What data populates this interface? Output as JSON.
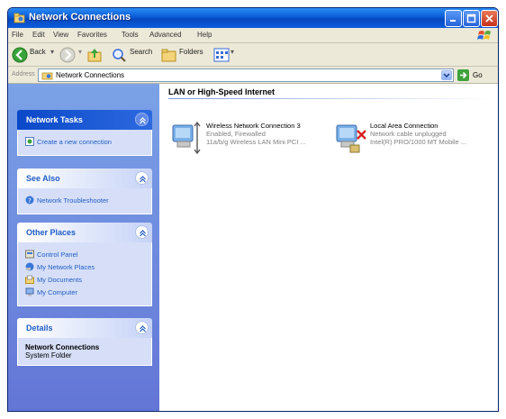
{
  "window": {
    "title": "Network Connections"
  },
  "menu": [
    "File",
    "Edit",
    "View",
    "Favorites",
    "Tools",
    "Advanced",
    "Help"
  ],
  "toolbar": {
    "back_label": "Back",
    "search_label": "Search",
    "folders_label": "Folders"
  },
  "address": {
    "label": "Address",
    "value": "Network Connections",
    "go_label": "Go"
  },
  "left": {
    "network_tasks": {
      "title": "Network Tasks",
      "items": [
        "Create a new connection"
      ]
    },
    "see_also": {
      "title": "See Also",
      "items": [
        "Network Troubleshooter"
      ]
    },
    "other_places": {
      "title": "Other Places",
      "items": [
        "Control Panel",
        "My Network Places",
        "My Documents",
        "My Computer"
      ]
    },
    "details": {
      "title": "Details",
      "name": "Network Connections",
      "type": "System Folder"
    }
  },
  "content": {
    "group_title": "LAN or High-Speed Internet",
    "connections": [
      {
        "name": "Wireless Network Connection 3",
        "status": "Enabled, Firewalled",
        "device": "11a/b/g Wireless LAN Mini PCI ..."
      },
      {
        "name": "Local Area Connection",
        "status": "Network cable unplugged",
        "device": "Intel(R) PRO/1000 MT Mobile ..."
      }
    ]
  },
  "colors": {
    "title_bar": "#0a5bd6",
    "task_pane": "#6f8fe0",
    "link": "#215dc6"
  }
}
